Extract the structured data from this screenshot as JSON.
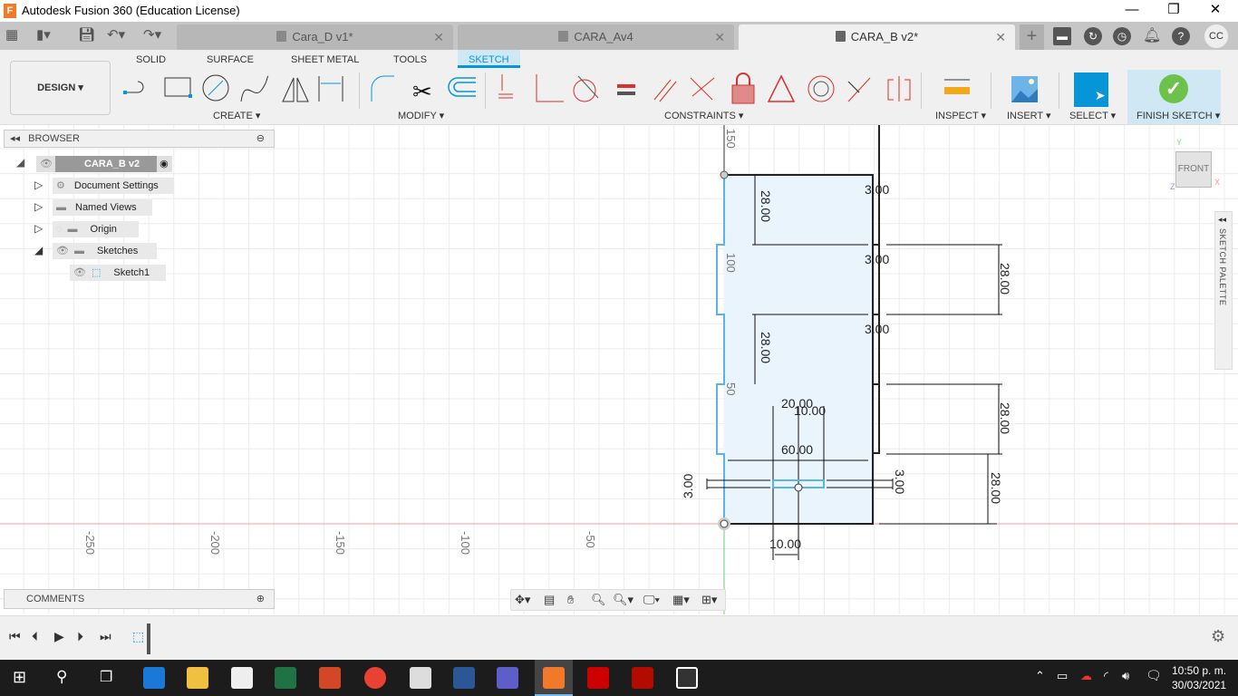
{
  "window": {
    "title": "Autodesk Fusion 360 (Education License)",
    "app_icon": "F",
    "minimize": "—",
    "restore": "❐",
    "close": "✕"
  },
  "tabs": [
    {
      "label": "Cara_D v1*",
      "active": false
    },
    {
      "label": "CARA_Av4",
      "active": false
    },
    {
      "label": "CARA_B v2*",
      "active": true
    }
  ],
  "header": {
    "new_tab": "+",
    "user_initials": "CC"
  },
  "ribbon": {
    "workspace": "DESIGN ▾",
    "tabs": [
      "SOLID",
      "SURFACE",
      "SHEET METAL",
      "TOOLS",
      "SKETCH"
    ],
    "active_tab": "SKETCH",
    "groups": {
      "create": "CREATE ▾",
      "modify": "MODIFY ▾",
      "constraints": "CONSTRAINTS ▾",
      "inspect": "INSPECT ▾",
      "insert": "INSERT ▾",
      "select": "SELECT ▾",
      "finish": "FINISH SKETCH ▾"
    }
  },
  "browser": {
    "title": "BROWSER",
    "root": "CARA_B v2",
    "items": [
      "Document Settings",
      "Named Views",
      "Origin",
      "Sketches",
      "Sketch1"
    ]
  },
  "comments": {
    "title": "COMMENTS"
  },
  "viewcube": {
    "face": "FRONT",
    "x": "X",
    "y": "Y",
    "z": "Z"
  },
  "sketch_palette": "SKETCH PALETTE",
  "axis_labels": {
    "vertical": [
      "150",
      "100",
      "50"
    ],
    "horizontal": [
      "-250",
      "-200",
      "-150",
      "-100",
      "-50"
    ]
  },
  "dimensions": {
    "d28a": "28.00",
    "d28b": "28.00",
    "d28c": "28.00",
    "d28d": "28.00",
    "d28e": "28.00",
    "t1": "3.00",
    "t2": "3.00",
    "t3": "3.00",
    "t4": "3.00",
    "t5": "3.00",
    "w20": "20.00",
    "w10top": "10.00",
    "w60": "60.00",
    "w10bot": "10.00"
  },
  "colors": {
    "accent": "#0696d7",
    "constraint_red": "#d9312b",
    "sketch_fill": "#eaf4fc",
    "profile_blue": "#5ab4e5",
    "finish_green": "#6cc24a"
  },
  "taskbar": {
    "time": "10:50 p. m.",
    "date": "30/03/2021"
  }
}
